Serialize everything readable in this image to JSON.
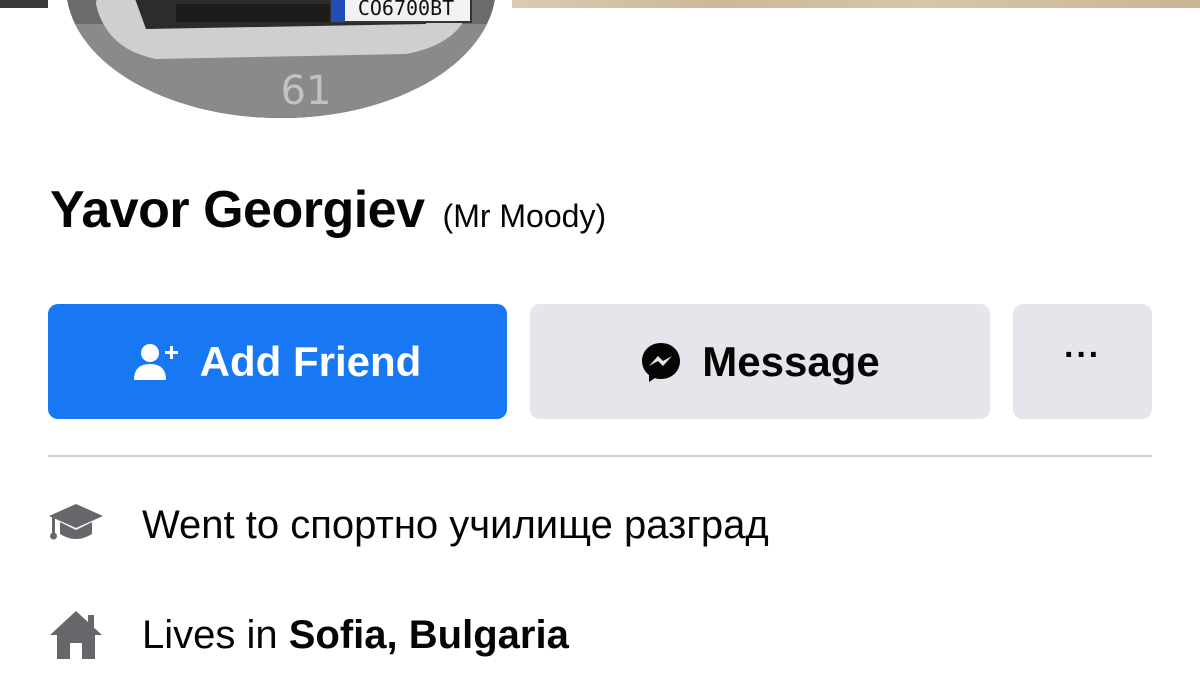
{
  "profile": {
    "name": "Yavor Georgiev",
    "nickname": "(Mr Moody)",
    "license_plate": "CO6700BT"
  },
  "actions": {
    "add_friend_label": "Add Friend",
    "message_label": "Message",
    "more_label": "···"
  },
  "intro": {
    "education": {
      "text": "Went to спортно училище разград",
      "icon": "graduation-cap-icon"
    },
    "residence": {
      "prefix": "Lives in ",
      "place": "Sofia, Bulgaria",
      "icon": "home-icon"
    }
  },
  "colors": {
    "primary_button": "#1877f2",
    "secondary_button": "#e4e6eb",
    "divider": "#ced0d4",
    "icon_gray": "#65676b"
  }
}
